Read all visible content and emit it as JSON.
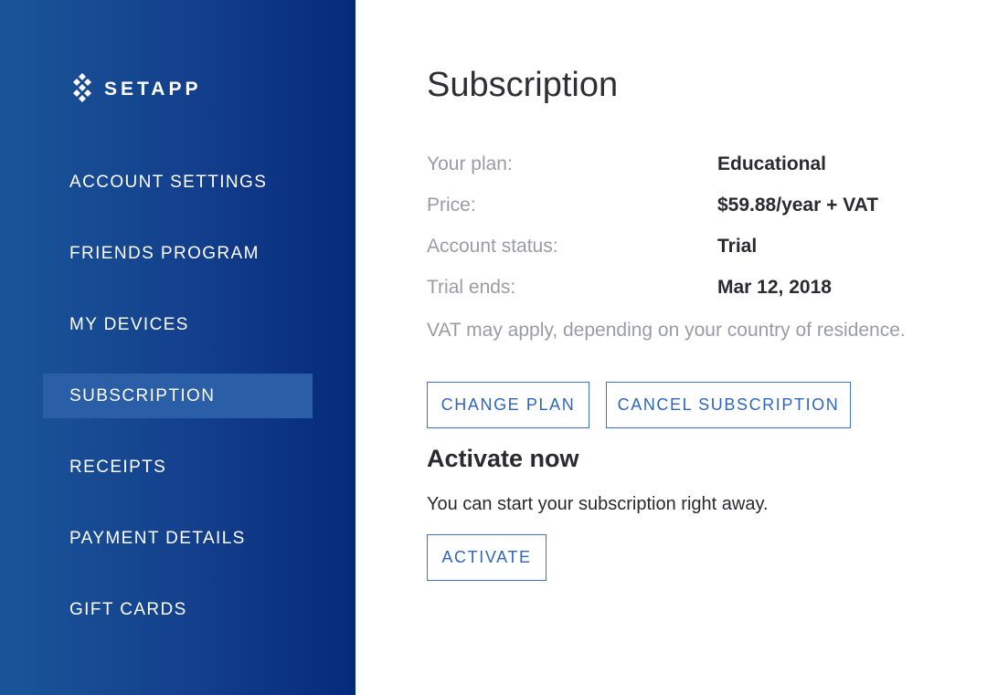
{
  "brand": {
    "name": "SETAPP",
    "icon": "setapp-logo-icon"
  },
  "colors": {
    "sidebar_gradient_start": "#1a5599",
    "sidebar_gradient_end": "#052a7a",
    "sidebar_active": "#2a5ea7",
    "accent": "#2f66bb",
    "label_gray": "#9b9ba6",
    "text_dark": "#2a2a30"
  },
  "sidebar": {
    "items": [
      {
        "label": "ACCOUNT SETTINGS",
        "active": false
      },
      {
        "label": "FRIENDS PROGRAM",
        "active": false
      },
      {
        "label": "MY DEVICES",
        "active": false
      },
      {
        "label": "SUBSCRIPTION",
        "active": true
      },
      {
        "label": "RECEIPTS",
        "active": false
      },
      {
        "label": "PAYMENT DETAILS",
        "active": false
      },
      {
        "label": "GIFT CARDS",
        "active": false
      }
    ]
  },
  "main": {
    "title": "Subscription",
    "details": [
      {
        "label": "Your plan:",
        "value": "Educational"
      },
      {
        "label": "Price:",
        "value": "$59.88/year + VAT"
      },
      {
        "label": "Account status:",
        "value": "Trial"
      },
      {
        "label": "Trial ends:",
        "value": "Mar 12, 2018"
      }
    ],
    "vat_note": "VAT may apply, depending on your country of residence.",
    "buttons": {
      "change_plan": "CHANGE PLAN",
      "cancel_subscription": "CANCEL SUBSCRIPTION"
    },
    "activate": {
      "heading": "Activate now",
      "text": "You can start your subscription right away.",
      "button": "ACTIVATE"
    }
  }
}
